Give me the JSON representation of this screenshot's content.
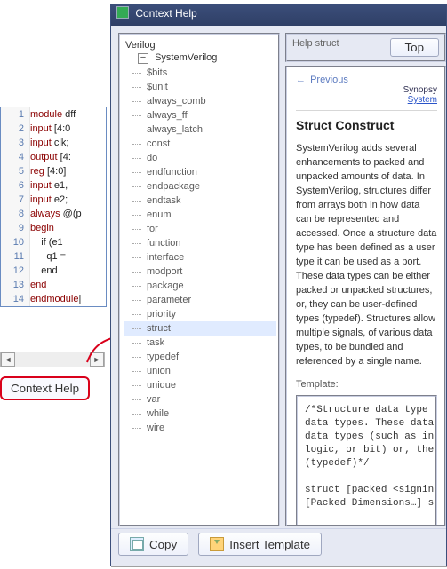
{
  "code": {
    "lines": [
      {
        "n": 1,
        "kw": "module",
        "txt": " dff"
      },
      {
        "n": 2,
        "kw": "input",
        "txt": " [4:0"
      },
      {
        "n": 3,
        "kw": "input",
        "txt": " clk;"
      },
      {
        "n": 4,
        "kw": "output",
        "txt": " [4:"
      },
      {
        "n": 5,
        "kw": "reg",
        "txt": " [4:0]"
      },
      {
        "n": 6,
        "kw": "input",
        "txt": " e1,"
      },
      {
        "n": 7,
        "kw": "input",
        "txt": " e2;"
      },
      {
        "n": 8,
        "kw": "always",
        "txt": " @(p"
      },
      {
        "n": 9,
        "kw": "begin",
        "txt": ""
      },
      {
        "n": 10,
        "kw": "",
        "txt": "    if (e1"
      },
      {
        "n": 11,
        "kw": "",
        "txt": "      q1 ="
      },
      {
        "n": 12,
        "kw": "",
        "txt": "    end"
      },
      {
        "n": 13,
        "kw": "end",
        "txt": ""
      },
      {
        "n": 14,
        "kw": "endmodule",
        "txt": "|"
      }
    ]
  },
  "context_help_button": "Context Help",
  "ch_title": "Context Help",
  "tree": {
    "root": "Verilog",
    "group": "SystemVerilog",
    "items": [
      "$bits",
      "$unit",
      "always_comb",
      "always_ff",
      "always_latch",
      "const",
      "do",
      "endfunction",
      "endpackage",
      "endtask",
      "enum",
      "for",
      "function",
      "interface",
      "modport",
      "package",
      "parameter",
      "priority",
      "struct",
      "task",
      "typedef",
      "union",
      "unique",
      "var",
      "while",
      "wire"
    ],
    "selected": "struct"
  },
  "help": {
    "header_label": "Help struct",
    "top_btn": "Top",
    "previous": "Previous",
    "src1": "Synopsy",
    "src2": "System",
    "title": "Struct Construct",
    "paragraph": "SystemVerilog adds several enhancements to packed and unpacked amounts of data. In SystemVerilog, structures differ from arrays both in how data can be represented and accessed. Once a structure data type has been defined as a user type it can be used as a port. These data types can be either packed or unpacked structures, or, they can be user-defined types (typedef). Structures allow multiple signals, of various data types, to be bundled and referenced by a single name.",
    "template_label": "Template:",
    "template_code": "/*Structure data type is a collection of\ndata types. These data types can be built-in\ndata types (such as int, integer, real,\nlogic, or bit) or, they can be user-defined\n(typedef)*/\n\nstruct [packed <signing>] {\n[Packed Dimensions…] struct_member;} \n\n\n//examples:"
  },
  "buttons": {
    "copy": "Copy",
    "insert": "Insert Template"
  }
}
